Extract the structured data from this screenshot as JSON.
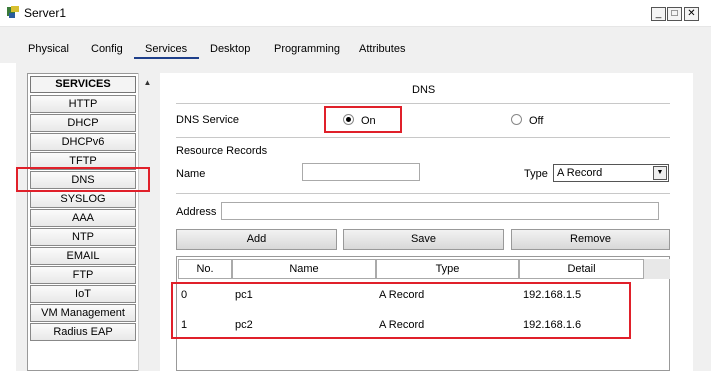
{
  "window": {
    "title": "Server1",
    "min_glyph": "_",
    "max_glyph": "□",
    "close_glyph": "✕"
  },
  "tabs": [
    {
      "label": "Physical"
    },
    {
      "label": "Config"
    },
    {
      "label": "Services",
      "active": true
    },
    {
      "label": "Desktop"
    },
    {
      "label": "Programming"
    },
    {
      "label": "Attributes"
    }
  ],
  "sidebar": {
    "header": "SERVICES",
    "items": [
      {
        "label": "HTTP"
      },
      {
        "label": "DHCP"
      },
      {
        "label": "DHCPv6"
      },
      {
        "label": "TFTP"
      },
      {
        "label": "DNS",
        "selected": true
      },
      {
        "label": "SYSLOG"
      },
      {
        "label": "AAA"
      },
      {
        "label": "NTP"
      },
      {
        "label": "EMAIL"
      },
      {
        "label": "FTP"
      },
      {
        "label": "IoT"
      },
      {
        "label": "VM Management"
      },
      {
        "label": "Radius EAP"
      }
    ],
    "scroll_up_glyph": "▲"
  },
  "dns": {
    "section_title": "DNS",
    "service_label": "DNS Service",
    "on_label": "On",
    "off_label": "Off",
    "service_state": "On",
    "resource_records_label": "Resource Records",
    "name_label": "Name",
    "name_value": "",
    "type_label": "Type",
    "type_value": "A Record",
    "type_arrow": "▼",
    "address_label": "Address",
    "address_value": "",
    "add_label": "Add",
    "save_label": "Save",
    "remove_label": "Remove",
    "table": {
      "columns": [
        "No.",
        "Name",
        "Type",
        "Detail"
      ],
      "rows": [
        {
          "no": "0",
          "name": "pc1",
          "type": "A Record",
          "detail": "192.168.1.5"
        },
        {
          "no": "1",
          "name": "pc2",
          "type": "A Record",
          "detail": "192.168.1.6"
        }
      ]
    }
  },
  "colors": {
    "highlight": "#e0202a",
    "tab_underline": "#1e3f8a"
  }
}
